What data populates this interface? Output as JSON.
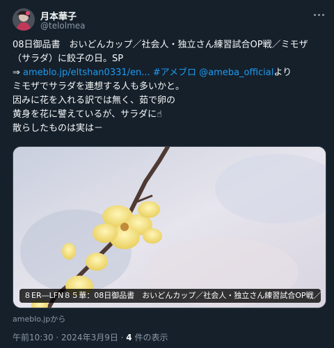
{
  "user": {
    "display_name": "月本華子",
    "handle": "@telolmea"
  },
  "icons": {
    "more": "more-dots-icon",
    "avatar": "avatar-image"
  },
  "tweet": {
    "line1": "08日御品書　おいどんカップ／社会人・独立さん練習試合OP戦／ミモザ",
    "line2": "（サラダ）に餃子の日。SP",
    "line3_prefix": "⇒ ",
    "line3_link": "ameblo.jp/eltshan0331/en...",
    "line3_hashtag": " #アメブロ",
    "line3_mention": " @ameba_official",
    "line3_suffix": "より",
    "line4": "ミモザでサラダを連想する人も多いかと。",
    "line5": "因みに花を入れる訳では無く、茹で卵の",
    "line6": "黄身を花に譬えているが、サラダに☝",
    "line7": "散らしたものは実は－"
  },
  "card": {
    "caption": "８ER―LFN８５華：08日御品書　おいどんカップ／社会人・独立さん練習試合OP戦／ミモ...",
    "source": "ameblo.jpから"
  },
  "meta": {
    "time": "午前10:30 · 2024年3月9日 · ",
    "views_count": "4",
    "views_label": " 件の表示"
  },
  "colors": {
    "background": "#15202b",
    "text": "#f7f9f9",
    "secondary": "#8b98a5",
    "link": "#1d9bf0"
  }
}
